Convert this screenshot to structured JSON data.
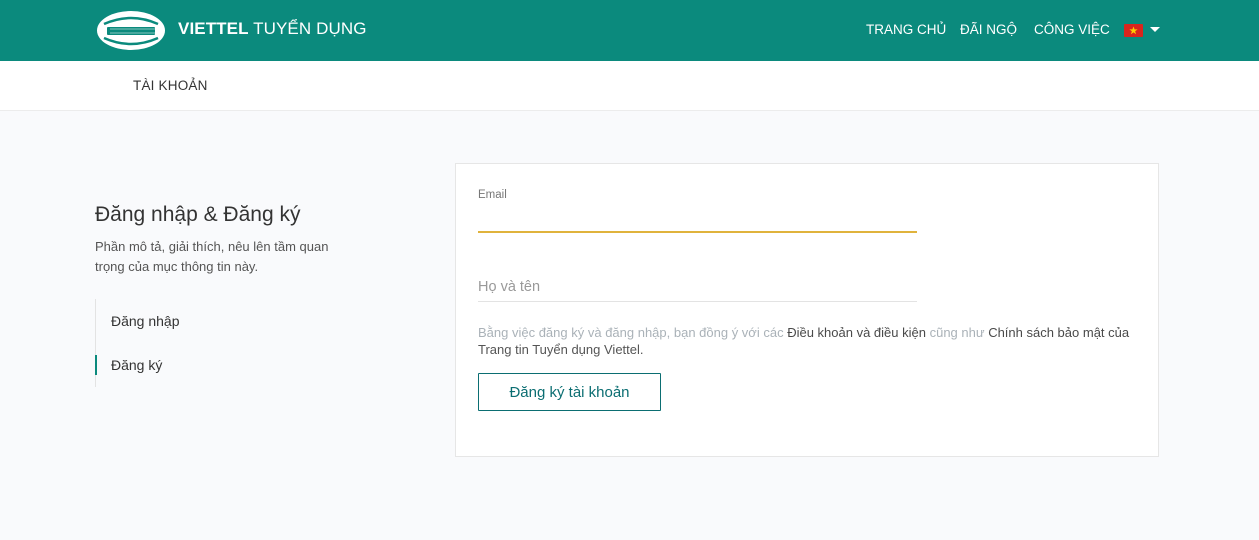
{
  "header": {
    "brand_bold": "VIETTEL",
    "brand_light": "TUYỂN DỤNG",
    "nav": [
      "TRANG CHỦ",
      "ĐÃI NGỘ",
      "CÔNG VIỆC"
    ],
    "language_flag": "vietnam-flag-icon",
    "bg_color": "#0b8a7d"
  },
  "subnav": {
    "account": "TÀI KHOẢN"
  },
  "sidebar": {
    "title": "Đăng nhập & Đăng ký",
    "description": "Phần mô tả, giải thích, nêu lên tầm quan trọng của mục thông tin này.",
    "items": [
      {
        "label": "Đăng nhập",
        "active": false
      },
      {
        "label": "Đăng ký",
        "active": true
      }
    ]
  },
  "form": {
    "email_label": "Email",
    "email_value": "",
    "name_placeholder": "Họ và tên",
    "terms_prefix": "Bằng việc đăng ký và đăng nhập, bạn đồng ý với các",
    "terms_link": "Điều khoản và điều kiện",
    "terms_middle": "cũng như",
    "privacy_link": "Chính sách bảo mật của",
    "terms_suffix": "Trang tin Tuyển dụng Viettel.",
    "submit_label": "Đăng ký tài khoản"
  },
  "colors": {
    "accent": "#0b8a7d",
    "focus_underline": "#e0b33c"
  }
}
